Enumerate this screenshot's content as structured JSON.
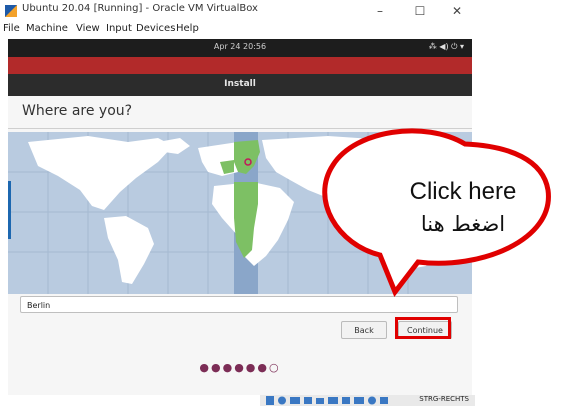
{
  "window": {
    "title": "Ubuntu 20.04 [Running] - Oracle VM VirtualBox",
    "minimize_glyph": "–",
    "maximize_glyph": "☐",
    "close_glyph": "✕"
  },
  "menubar": [
    "File",
    "Machine",
    "View",
    "Input",
    "Devices",
    "Help"
  ],
  "vm_topbar": {
    "clock": "Apr 24  20:56",
    "tray_icons": [
      "network-icon",
      "volume-icon",
      "power-icon",
      "chevron-down-icon"
    ],
    "tray_glyphs": "⁂ ◀) ⏻ ▾"
  },
  "installer": {
    "title": "Install",
    "heading": "Where are you?",
    "city_value": "Berlin",
    "back_label": "Back",
    "continue_label": "Continue",
    "progress_dots": "●●●●●●○",
    "progress": {
      "step": 6,
      "total": 7
    }
  },
  "host_tray": {
    "keys_label": "STRG-RECHTS"
  },
  "callout": {
    "line1": "Click here",
    "line2": "اضغط هنا"
  },
  "colors": {
    "callout_border": "#e00000",
    "highlight": "#e00000",
    "map_land": "#ffffff",
    "map_timezone_band": "#8aa6c9",
    "selected_region": "#7dc064"
  }
}
